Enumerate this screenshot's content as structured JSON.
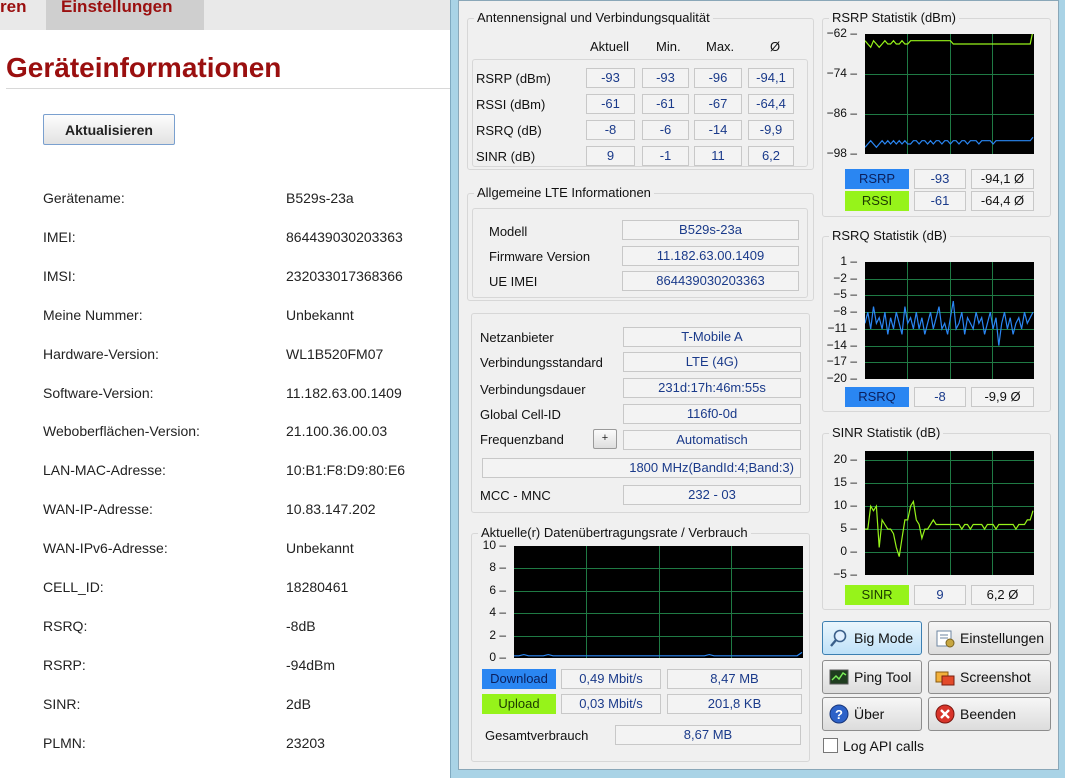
{
  "web": {
    "nav": {
      "tab_partial": "ren",
      "tab_active": "Einstellungen"
    },
    "page_title": "Geräteinformationen",
    "refresh_button": "Aktualisieren",
    "info": [
      {
        "label": "Gerätename:",
        "value": "B529s-23a"
      },
      {
        "label": "IMEI:",
        "value": "864439030203363"
      },
      {
        "label": "IMSI:",
        "value": "232033017368366"
      },
      {
        "label": "Meine Nummer:",
        "value": "Unbekannt"
      },
      {
        "label": "Hardware-Version:",
        "value": "WL1B520FM07"
      },
      {
        "label": "Software-Version:",
        "value": "11.182.63.00.1409"
      },
      {
        "label": "Weboberflächen-Version:",
        "value": "21.100.36.00.03"
      },
      {
        "label": "LAN-MAC-Adresse:",
        "value": "10:B1:F8:D9:80:E6"
      },
      {
        "label": "WAN-IP-Adresse:",
        "value": "10.83.147.202"
      },
      {
        "label": "WAN-IPv6-Adresse:",
        "value": "Unbekannt"
      },
      {
        "label": "CELL_ID:",
        "value": "18280461"
      },
      {
        "label": "RSRQ:",
        "value": "-8dB"
      },
      {
        "label": "RSRP:",
        "value": "-94dBm"
      },
      {
        "label": "SINR:",
        "value": "2dB"
      },
      {
        "label": "PLMN:",
        "value": "23203"
      }
    ]
  },
  "app": {
    "signal_group": {
      "title": "Antennensignal und Verbindungsqualität",
      "headers": [
        "Aktuell",
        "Min.",
        "Max.",
        "Ø"
      ],
      "rows": [
        {
          "label": "RSRP (dBm)",
          "values": [
            "-93",
            "-93",
            "-96",
            "-94,1"
          ]
        },
        {
          "label": "RSSI (dBm)",
          "values": [
            "-61",
            "-61",
            "-67",
            "-64,4"
          ]
        },
        {
          "label": "RSRQ (dB)",
          "values": [
            "-8",
            "-6",
            "-14",
            "-9,9"
          ]
        },
        {
          "label": "SINR (dB)",
          "values": [
            "9",
            "-1",
            "11",
            "6,2"
          ]
        }
      ]
    },
    "lte_group": {
      "title": "Allgemeine LTE Informationen",
      "rows": [
        {
          "label": "Modell",
          "value": "B529s-23a"
        },
        {
          "label": "Firmware Version",
          "value": "11.182.63.00.1409"
        },
        {
          "label": "UE IMEI",
          "value": "864439030203363"
        }
      ]
    },
    "network_group": {
      "provider_label": "Netzanbieter",
      "provider": "T-Mobile A",
      "standard_label": "Verbindungsstandard",
      "standard": "LTE (4G)",
      "duration_label": "Verbindungsdauer",
      "duration": "231d:17h:46m:55s",
      "cellid_label": "Global Cell-ID",
      "cellid": "116f0-0d",
      "band_label": "Frequenzband",
      "band_button": "+",
      "band_mode": "Automatisch",
      "band_detail": "1800 MHz(BandId:4;Band:3)",
      "mccmnc_label": "MCC - MNC",
      "mccmnc": "232 - 03"
    },
    "rate_group": {
      "title": "Aktuelle(r) Datenübertragungsrate / Verbrauch",
      "download_label": "Download",
      "download_rate": "0,49 Mbit/s",
      "download_total": "8,47 MB",
      "upload_label": "Upload",
      "upload_rate": "0,03 Mbit/s",
      "upload_total": "201,8 KB",
      "total_label": "Gesamtverbrauch",
      "total": "8,67 MB"
    },
    "rsrp_stats": {
      "title": "RSRP Statistik (dBm)",
      "rsrp_label": "RSRP",
      "rsrp_value": "-93",
      "rsrp_avg": "-94,1 Ø",
      "rssi_label": "RSSI",
      "rssi_value": "-61",
      "rssi_avg": "-64,4 Ø"
    },
    "rsrq_stats": {
      "title": "RSRQ Statistik (dB)",
      "label": "RSRQ",
      "value": "-8",
      "avg": "-9,9 Ø"
    },
    "sinr_stats": {
      "title": "SINR Statistik (dB)",
      "label": "SINR",
      "value": "9",
      "avg": "6,2 Ø"
    },
    "buttons": {
      "big_mode": "Big Mode",
      "settings": "Einstellungen",
      "ping": "Ping Tool",
      "screenshot": "Screenshot",
      "about": "Über",
      "quit": "Beenden"
    },
    "log_api_label": "Log API calls",
    "colors": {
      "rsrp": "#2a86f2",
      "rssi": "#96f31a",
      "plot_bg": "#000000",
      "grid": "#1f7a44",
      "accent_red": "#9a0f0f"
    }
  },
  "chart_data": [
    {
      "type": "line",
      "title": "RSRP Statistik (dBm)",
      "ylim": [
        -98,
        -62
      ],
      "yticks": [
        -62,
        -74,
        -86,
        -98
      ],
      "series": [
        {
          "name": "RSSI",
          "color": "#96f31a",
          "values": [
            -64,
            -65,
            -66,
            -64,
            -65,
            -66,
            -65,
            -64,
            -65,
            -65,
            -64,
            -65,
            -65,
            -64,
            -65,
            -65,
            -64,
            -64,
            -64,
            -64,
            -64,
            -64,
            -64,
            -64,
            -64,
            -64,
            -64,
            -64,
            -64,
            -64,
            -64,
            -65,
            -65,
            -65,
            -65,
            -65,
            -65,
            -65,
            -65,
            -65,
            -65,
            -65,
            -65,
            -65,
            -65,
            -65,
            -65,
            -65,
            -65,
            -65,
            -65,
            -65,
            -65,
            -65,
            -65,
            -65,
            -65,
            -65,
            -65,
            -61
          ]
        },
        {
          "name": "RSRP",
          "color": "#2a86f2",
          "values": [
            -96,
            -95,
            -94,
            -95,
            -96,
            -95,
            -94,
            -95,
            -94,
            -95,
            -94,
            -95,
            -94,
            -95,
            -94,
            -95,
            -95,
            -94,
            -94,
            -95,
            -94,
            -94,
            -95,
            -94,
            -95,
            -94,
            -94,
            -95,
            -94,
            -94,
            -95,
            -94,
            -94,
            -95,
            -94,
            -94,
            -95,
            -94,
            -94,
            -94,
            -95,
            -94,
            -94,
            -94,
            -94,
            -95,
            -94,
            -94,
            -94,
            -94,
            -94,
            -94,
            -94,
            -94,
            -94,
            -94,
            -94,
            -94,
            -94,
            -93
          ]
        }
      ]
    },
    {
      "type": "line",
      "title": "RSRQ Statistik (dB)",
      "ylim": [
        -20,
        1
      ],
      "yticks": [
        1,
        -2,
        -5,
        -8,
        -11,
        -14,
        -17,
        -20
      ],
      "series": [
        {
          "name": "RSRQ",
          "color": "#2a86f2",
          "values": [
            -10,
            -8,
            -11,
            -7,
            -10,
            -9,
            -11,
            -8,
            -12,
            -9,
            -11,
            -8,
            -10,
            -12,
            -7,
            -10,
            -9,
            -11,
            -8,
            -11,
            -9,
            -12,
            -10,
            -8,
            -11,
            -9,
            -7,
            -11,
            -10,
            -12,
            -9,
            -6,
            -11,
            -10,
            -8,
            -12,
            -9,
            -10,
            -11,
            -8,
            -10,
            -9,
            -12,
            -10,
            -8,
            -11,
            -9,
            -14,
            -10,
            -8,
            -11,
            -9,
            -12,
            -10,
            -9,
            -11,
            -8,
            -10,
            -9,
            -8
          ]
        }
      ]
    },
    {
      "type": "line",
      "title": "SINR Statistik (dB)",
      "ylim": [
        -5,
        22
      ],
      "yticks": [
        20,
        15,
        10,
        5,
        0,
        -5
      ],
      "series": [
        {
          "name": "SINR",
          "color": "#96f31a",
          "values": [
            5,
            5,
            10,
            9,
            10,
            1,
            7,
            6,
            5,
            5,
            4,
            1,
            -1,
            3,
            7,
            7,
            10,
            11,
            7,
            6,
            3,
            5,
            5,
            6,
            7,
            6,
            6,
            6,
            6,
            6,
            6,
            6,
            6,
            6,
            5,
            6,
            6,
            5,
            6,
            6,
            6,
            6,
            5,
            6,
            6,
            6,
            5,
            6,
            6,
            6,
            6,
            6,
            6,
            5,
            6,
            6,
            6,
            7,
            7,
            9
          ]
        }
      ]
    },
    {
      "type": "line",
      "title": "Aktuelle(r) Datenübertragungsrate / Verbrauch",
      "ylim": [
        0,
        10
      ],
      "yticks": [
        10,
        8,
        6,
        4,
        2,
        0
      ],
      "series": [
        {
          "name": "Download",
          "color": "#2a86f2",
          "values": [
            0.2,
            0.2,
            0.3,
            0.2,
            0.2,
            0.2,
            0.2,
            0.3,
            0.2,
            0.2,
            0.2,
            0.2,
            0.2,
            0.2,
            0.2,
            0.2,
            0.2,
            0.2,
            0.2,
            0.2,
            0.2,
            0.2,
            0.2,
            0.2,
            0.2,
            0.2,
            0.2,
            0.2,
            0.2,
            0.2,
            0.2,
            0.2,
            0.2,
            0.2,
            0.2,
            0.2,
            0.2,
            0.2,
            0.2,
            0.2,
            0.3,
            0.2,
            0.2,
            0.2,
            0.2,
            0.2,
            0.2,
            0.2,
            0.2,
            0.2,
            0.2,
            0.2,
            0.2,
            0.2,
            0.2,
            0.2,
            0.2,
            0.2,
            0.2,
            0.5
          ]
        }
      ]
    }
  ]
}
